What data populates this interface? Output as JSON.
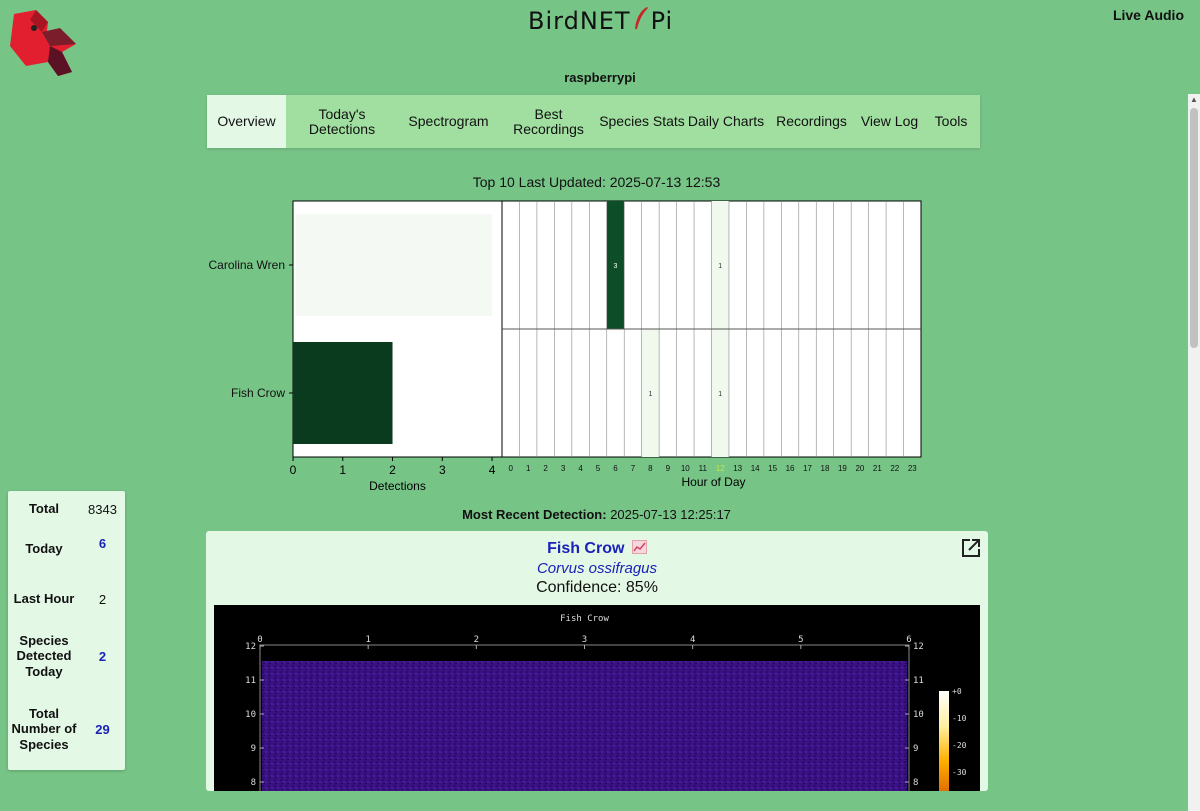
{
  "header": {
    "brand_left": "BirdNET",
    "brand_right": "Pi",
    "live_audio": "Live Audio",
    "hostname": "raspberrypi"
  },
  "nav": [
    {
      "label": "Overview",
      "active": true
    },
    {
      "label": "Today's Detections"
    },
    {
      "label": "Spectrogram"
    },
    {
      "label": "Best Recordings"
    },
    {
      "label": "Species Stats"
    },
    {
      "label": "Daily Charts"
    },
    {
      "label": "Recordings"
    },
    {
      "label": "View Log"
    },
    {
      "label": "Tools"
    }
  ],
  "top10_title": "Top 10 Last Updated: 2025-07-13 12:53",
  "chart_data": {
    "type": "bar",
    "species": [
      "Carolina Wren",
      "Fish Crow"
    ],
    "detections": [
      4,
      2
    ],
    "xlabel": "Detections",
    "xticks": [
      0,
      1,
      2,
      3,
      4
    ],
    "xlim": [
      0,
      4.2
    ],
    "hour_xlabel": "Hour of Day",
    "hours": [
      0,
      1,
      2,
      3,
      4,
      5,
      6,
      7,
      8,
      9,
      10,
      11,
      12,
      13,
      14,
      15,
      16,
      17,
      18,
      19,
      20,
      21,
      22,
      23
    ],
    "current_hour": 12,
    "hourly_counts": [
      {
        "species": "Carolina Wren",
        "hour": 6,
        "count": 3
      },
      {
        "species": "Carolina Wren",
        "hour": 12,
        "count": 1
      },
      {
        "species": "Fish Crow",
        "hour": 8,
        "count": 1
      },
      {
        "species": "Fish Crow",
        "hour": 12,
        "count": 1
      }
    ],
    "colors": {
      "dark": "#0b3b1f",
      "light": "#f4faf3",
      "current_hour_label": "#c8e53c"
    }
  },
  "recent": {
    "label": "Most Recent Detection:",
    "time": "2025-07-13 12:25:17"
  },
  "stats": [
    {
      "label": "Total",
      "value": "8343",
      "link": false
    },
    {
      "label": "Today",
      "value": "6",
      "link": true
    },
    {
      "label": "Last Hour",
      "value": "2",
      "link": false
    },
    {
      "label": "Species Detected Today",
      "value": "2",
      "link": true
    },
    {
      "label": "Total Number of Species",
      "value": "29",
      "link": true
    }
  ],
  "detection_card": {
    "common_name": "Fish Crow",
    "scientific_name": "Corvus ossifragus",
    "confidence": "Confidence: 85%",
    "spectrogram": {
      "title": "Fish Crow",
      "time_ticks": [
        "0",
        "1",
        "2",
        "3",
        "4",
        "5",
        "6"
      ],
      "freq_ticks": [
        "12",
        "11",
        "10",
        "9",
        "8"
      ],
      "db_ticks": [
        "+0",
        "-10",
        "-20",
        "-30"
      ]
    }
  }
}
